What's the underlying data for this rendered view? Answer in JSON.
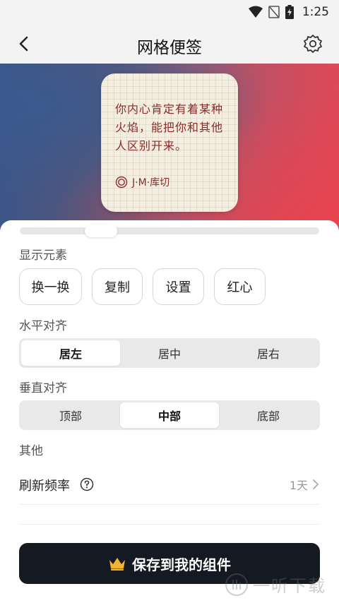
{
  "status_bar": {
    "time": "1:25"
  },
  "header": {
    "title": "网格便签",
    "back_icon": "chevron-left-icon",
    "settings_icon": "gear-icon"
  },
  "preview": {
    "quote": "你内心肯定有着某种火焰，能把你和其他人区别开来。",
    "author": "J·M·库切",
    "author_icon": "circle-icon"
  },
  "display_elements": {
    "label": "显示元素",
    "buttons": [
      "换一换",
      "复制",
      "设置",
      "红心"
    ]
  },
  "horizontal_align": {
    "label": "水平对齐",
    "options": [
      "居左",
      "居中",
      "居右"
    ],
    "selected": "居左"
  },
  "vertical_align": {
    "label": "垂直对齐",
    "options": [
      "顶部",
      "中部",
      "底部"
    ],
    "selected": "中部"
  },
  "other": {
    "label": "其他",
    "refresh_label": "刷新频率",
    "refresh_value": "1天",
    "help_icon": "question-circle-icon"
  },
  "save_button": {
    "label": "保存到我的组件",
    "icon": "crown-icon"
  },
  "watermark": {
    "text": "一听下载"
  },
  "colors": {
    "primary_dark": "#141922",
    "quote_text": "#8a2c2a",
    "crown": "#f2b233"
  }
}
